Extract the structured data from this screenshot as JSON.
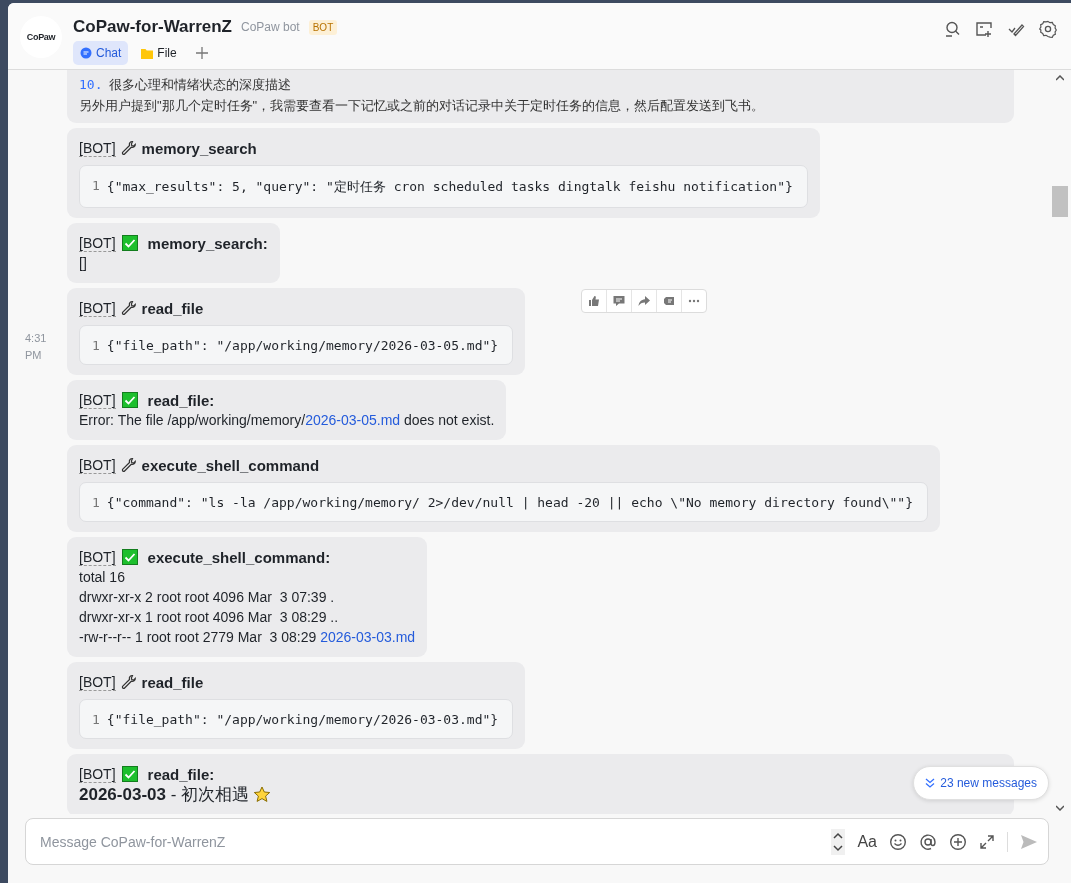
{
  "header": {
    "logo_text": "CoPaw",
    "title": "CoPaw-for-WarrenZ",
    "subtitle": "CoPaw bot",
    "badge": "BOT",
    "tabs": [
      {
        "label": "Chat",
        "selected": true
      },
      {
        "label": "File",
        "selected": false
      }
    ]
  },
  "messages": [
    {
      "kind": "text",
      "lines": [
        {
          "number": "10.",
          "text": "很多心理和情绪状态的深度描述"
        },
        {
          "text": "另外用户提到\"那几个定时任务\"，我需要查看一下记忆或之前的对话记录中关于定时任务的信息，然后配置发送到飞书。"
        }
      ]
    },
    {
      "kind": "call",
      "tag": "[BOT]",
      "tool": "memory_search",
      "code": [
        {
          "num": "1",
          "text": "{\"max_results\": 5, \"query\": \"定时任务 cron scheduled tasks dingtalk feishu notification\"}"
        }
      ]
    },
    {
      "kind": "result",
      "tag": "[BOT]",
      "tool": "**memory_search**:",
      "lines": [
        {
          "parts": [
            {
              "text": "[]"
            }
          ]
        }
      ]
    },
    {
      "kind": "call",
      "tag": "[BOT]",
      "tool": "read_file",
      "time": "4:31 PM",
      "toolbar_shown": true,
      "code": [
        {
          "num": "1",
          "text": "{\"file_path\": \"/app/working/memory/2026-03-05.md\"}"
        }
      ]
    },
    {
      "kind": "result",
      "tag": "[BOT]",
      "tool": "**read_file**:",
      "lines": [
        {
          "parts": [
            {
              "text": "Error: The file /app/working/memory/"
            },
            {
              "text": "2026-03-05.md",
              "link": true
            },
            {
              "text": " does not exist."
            }
          ]
        }
      ]
    },
    {
      "kind": "call",
      "tag": "[BOT]",
      "tool": "execute_shell_command",
      "code": [
        {
          "num": "1",
          "text": "{\"command\": \"ls -la /app/working/memory/ 2>/dev/null | head -20 || echo \\\"No memory directory found\\\"\"}"
        }
      ]
    },
    {
      "kind": "result",
      "tag": "[BOT]",
      "tool": "**execute_shell_command**:",
      "lines": [
        {
          "parts": [
            {
              "text": "total 16"
            }
          ]
        },
        {
          "parts": [
            {
              "text": "drwxr-xr-x 2 root root 4096 Mar  3 07:39 ."
            }
          ]
        },
        {
          "parts": [
            {
              "text": "drwxr-xr-x 1 root root 4096 Mar  3 08:29 .."
            }
          ]
        },
        {
          "parts": [
            {
              "text": "-rw-r--r-- 1 root root 2779 Mar  3 08:29 "
            },
            {
              "text": "2026-03-03.md",
              "link": true
            }
          ]
        }
      ]
    },
    {
      "kind": "call",
      "tag": "[BOT]",
      "tool": "read_file",
      "code": [
        {
          "num": "1",
          "text": "{\"file_path\": \"/app/working/memory/2026-03-03.md\"}"
        }
      ]
    },
    {
      "kind": "result",
      "tag": "[BOT]",
      "tool": "**read_file**:",
      "wide": true,
      "lines": [
        {
          "kind": "heading",
          "parts": [
            {
              "text": "**2026-03-03** - 初次相遇"
            }
          ]
        }
      ]
    }
  ],
  "new_messages": "23 new messages",
  "composer": {
    "placeholder": "Message CoPaw-for-WarrenZ",
    "format_label": "Aa"
  }
}
